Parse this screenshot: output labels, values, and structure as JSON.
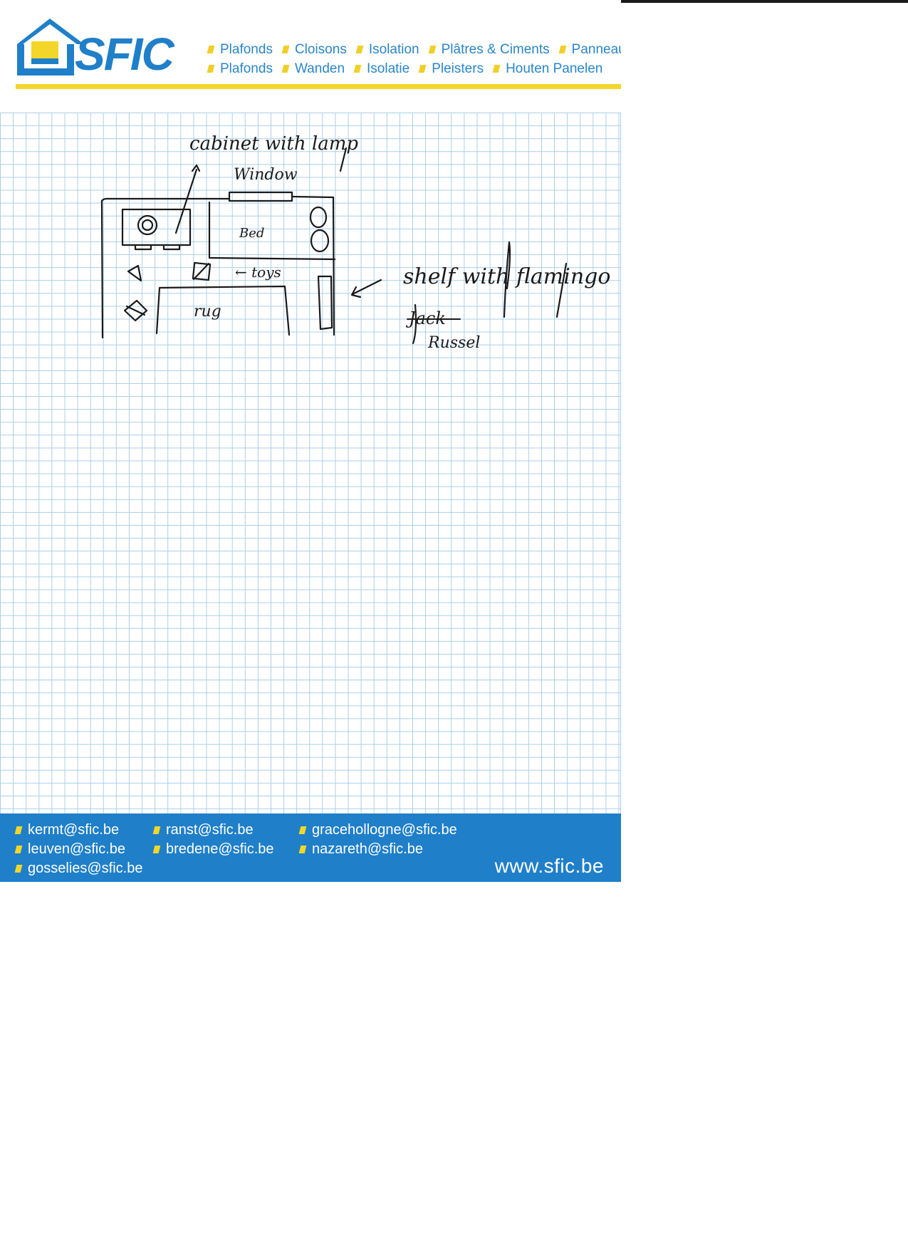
{
  "header": {
    "brand": "SFIC",
    "services_fr": [
      "Plafonds",
      "Cloisons",
      "Isolation",
      "Plâtres & Ciments",
      "Panneaux"
    ],
    "services_nl": [
      "Plafonds",
      "Wanden",
      "Isolatie",
      "Pleisters",
      "Houten Panelen"
    ]
  },
  "sketch": {
    "label_cabinet": "cabinet with lamp",
    "label_window": "Window",
    "label_bed": "Bed",
    "label_toys": "← toys",
    "label_rug": "rug",
    "label_shelf": "shelf with flamingo",
    "label_jack_struck": "Jack",
    "label_russel": "Russel"
  },
  "footer": {
    "emails_col1": [
      "kermt@sfic.be",
      "leuven@sfic.be",
      "gosselies@sfic.be"
    ],
    "emails_col2": [
      "ranst@sfic.be",
      "bredene@sfic.be"
    ],
    "emails_col3": [
      "gracehollogne@sfic.be",
      "nazareth@sfic.be"
    ],
    "website": "www.sfic.be"
  },
  "colors": {
    "brand_blue": "#1f7fc9",
    "accent_yellow": "#f3d629",
    "grid_blue": "#a9cfe8",
    "ink": "#1a1a1a"
  }
}
